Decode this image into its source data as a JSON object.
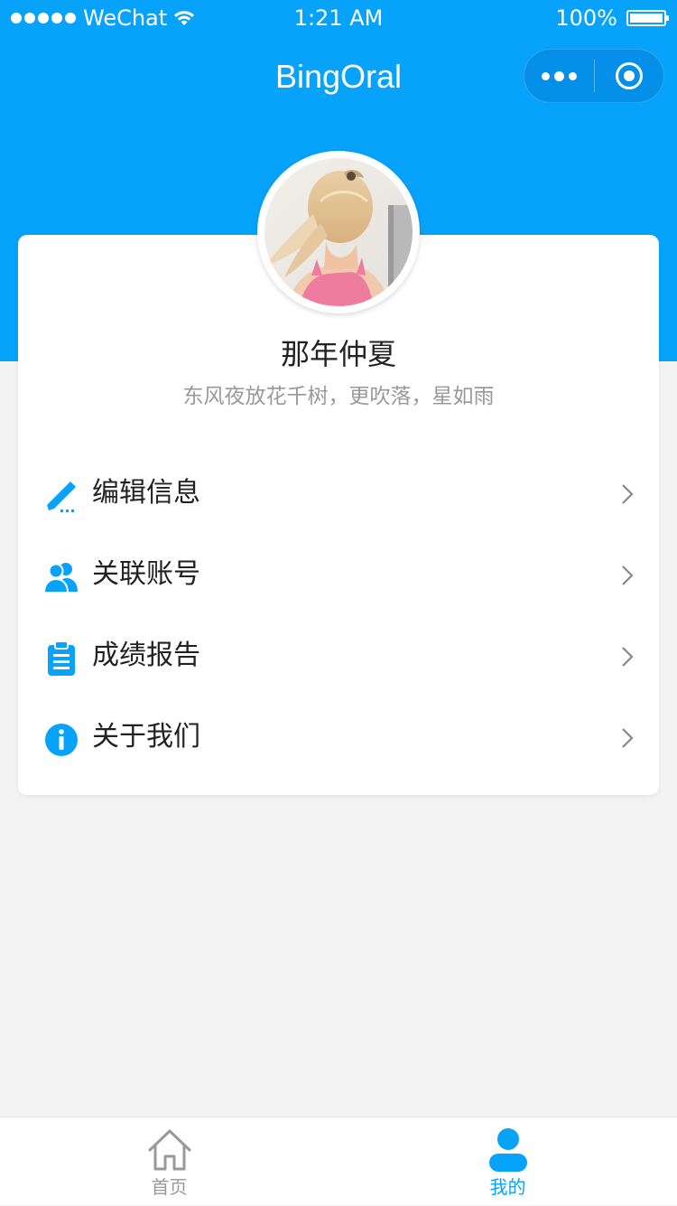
{
  "status_bar": {
    "carrier": "WeChat",
    "time": "1:21 AM",
    "battery": "100%",
    "battery_level": 1.0
  },
  "nav": {
    "title": "BingOral",
    "more_icon": "more-dots-icon",
    "close_icon": "target-circle-icon"
  },
  "profile": {
    "name": "那年仲夏",
    "bio": "东风夜放花千树，更吹落，星如雨"
  },
  "menu": {
    "items": [
      {
        "label": "编辑信息",
        "icon": "pencil-icon"
      },
      {
        "label": "关联账号",
        "icon": "users-icon"
      },
      {
        "label": "成绩报告",
        "icon": "clipboard-icon"
      },
      {
        "label": "关于我们",
        "icon": "info-icon"
      }
    ]
  },
  "tab_bar": {
    "tabs": [
      {
        "label": "首页",
        "icon": "home-icon"
      },
      {
        "label": "我的",
        "icon": "person-icon"
      }
    ],
    "active": "我的"
  },
  "colors": {
    "primary": "#07a3fb",
    "background": "#f3f3f3",
    "card": "#ffffff",
    "text": "#222222",
    "muted": "#999999"
  }
}
